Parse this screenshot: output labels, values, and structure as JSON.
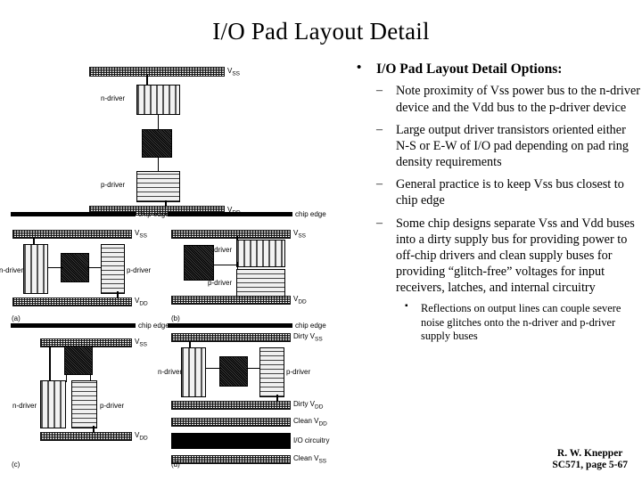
{
  "slide": {
    "title": "I/O Pad Layout Detail",
    "footer_line1": "R. W. Knepper",
    "footer_line2": "SC571, page 5-67"
  },
  "bullets": {
    "level1": "I/O Pad Layout Detail Options:",
    "marker1": "•",
    "marker2": "–",
    "marker3": "▪",
    "items": [
      "Note proximity of Vss power bus to the n-driver device and the Vdd bus to the p-driver device",
      "Large output driver transistors oriented either N-S or E-W of I/O pad depending on pad ring density requirements",
      "General practice is to keep Vss bus closest to chip edge",
      "Some chip designs separate Vss and Vdd buses into a dirty supply bus for providing power to off-chip drivers and clean supply buses for providing “glitch-free” voltages for input receivers, latches, and internal circuitry"
    ],
    "subitem": "Reflections on output lines can couple severe noise glitches onto the n-driver and p-driver supply buses"
  },
  "figure": {
    "labels": {
      "vss": "V",
      "vss_sub": "SS",
      "vdd": "V",
      "vdd_sub": "DD",
      "n_driver": "n-driver",
      "p_driver": "p-driver",
      "chip_edge": "chip edge",
      "dirty_vss": "Dirty V",
      "dirty_vdd": "Dirty V",
      "clean_vdd": "Clean V",
      "clean_vss": "Clean V",
      "io_circuitry": "I/O circuitry"
    },
    "panels": {
      "top": "",
      "a": "(a)",
      "b": "(b)",
      "c": "(c)",
      "d": "(d)"
    }
  },
  "colors": {
    "ink": "#000000",
    "paper": "#ffffff",
    "pad_fill": "#1a1a1a"
  }
}
